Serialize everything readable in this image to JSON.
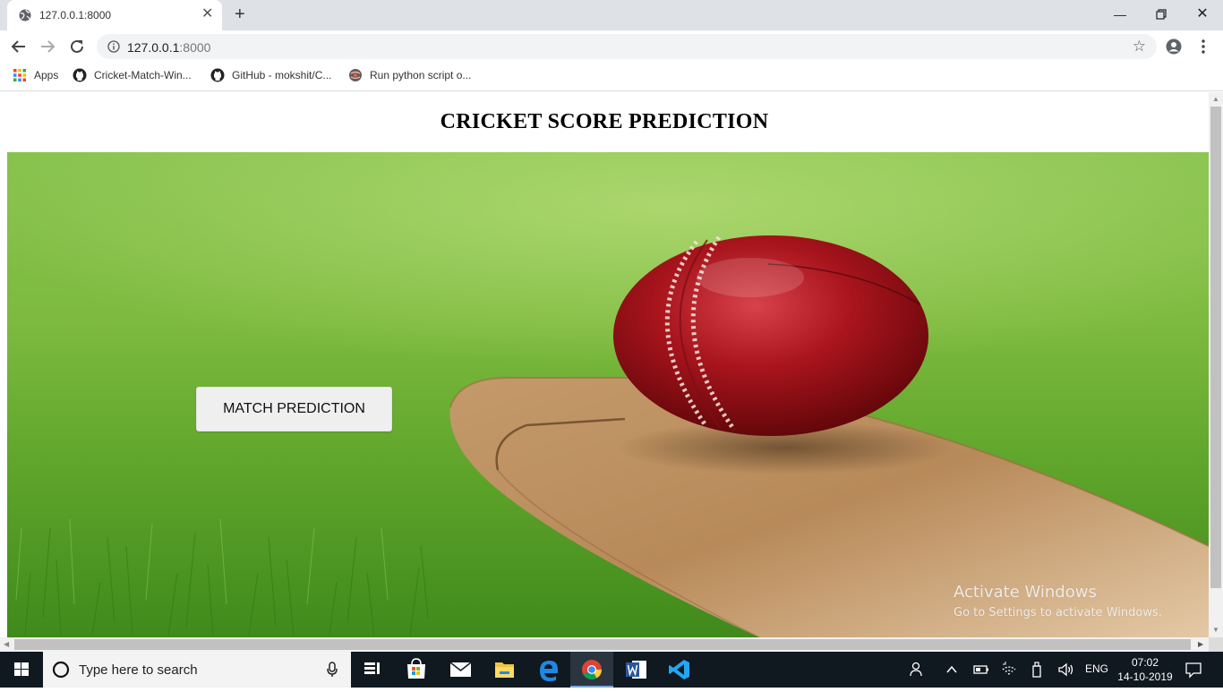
{
  "browser": {
    "tab_title": "127.0.0.1:8000",
    "url_host": "127.0.0.1",
    "url_port": ":8000",
    "bookmarks": [
      {
        "label": "Apps"
      },
      {
        "label": "Cricket-Match-Win..."
      },
      {
        "label": "GitHub - mokshit/C..."
      },
      {
        "label": "Run python script o..."
      }
    ]
  },
  "page": {
    "title": "CRICKET SCORE PREDICTION",
    "button_label": "MATCH PREDICTION"
  },
  "watermark": {
    "line1": "Activate Windows",
    "line2": "Go to Settings to activate Windows."
  },
  "taskbar": {
    "search_placeholder": "Type here to search",
    "language": "ENG",
    "time": "07:02",
    "date": "14-10-2019"
  },
  "colors": {
    "accent": "#7aa7d8",
    "taskbar": "#101820",
    "tabstrip": "#dee1e6"
  }
}
